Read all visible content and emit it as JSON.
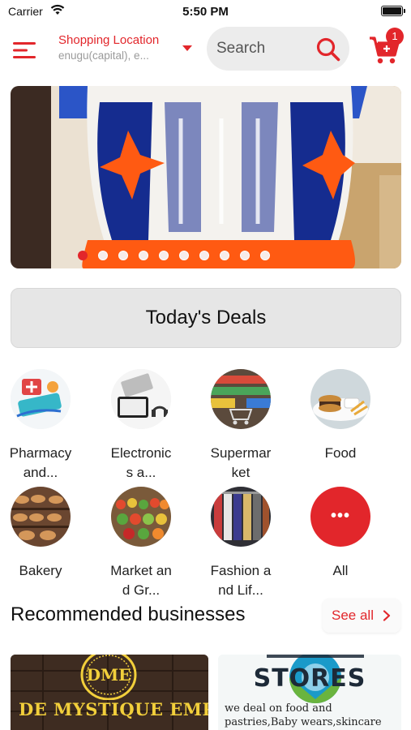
{
  "status_bar": {
    "carrier": "Carrier",
    "time": "5:50 PM"
  },
  "header": {
    "location_title": "Shopping Location",
    "location_value": "enugu(capital), e...",
    "search_placeholder": "Search",
    "cart_count": "1"
  },
  "banner": {
    "slide_count": 10,
    "active_slide": 1
  },
  "deals": {
    "label": "Today's Deals"
  },
  "categories": [
    {
      "label": "Pharmacy and...",
      "icon": "pharmacy-icon"
    },
    {
      "label": "Electronics a...",
      "icon": "electronics-icon"
    },
    {
      "label": "Supermarket",
      "icon": "supermarket-icon"
    },
    {
      "label": "Food",
      "icon": "food-icon"
    },
    {
      "label": "Bakery",
      "icon": "bakery-icon"
    },
    {
      "label": "Market and Gr...",
      "icon": "market-icon"
    },
    {
      "label": "Fashion and Lif...",
      "icon": "fashion-icon"
    },
    {
      "label": "All",
      "icon": "more-icon"
    }
  ],
  "recommended": {
    "title": "Recommended businesses",
    "see_all": "See all",
    "businesses": [
      {
        "name": "DE MYSTIQUE EMPIRE",
        "logo_text": "DME"
      },
      {
        "name": "STORES",
        "description": "we deal on food and pastries,Baby wears,skincare products,Ad of al"
      }
    ]
  },
  "colors": {
    "accent": "#e2262b",
    "background": "#ffffff",
    "deals_bg": "#e6e6e6"
  }
}
